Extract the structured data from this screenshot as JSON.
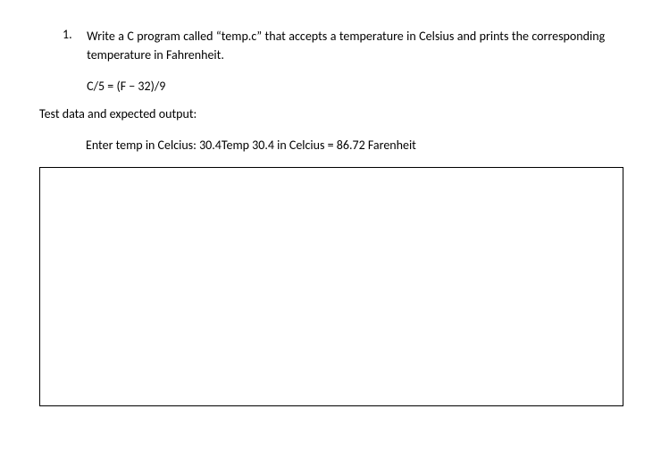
{
  "question": {
    "number": "1.",
    "prompt": "Write a C program called “temp.c” that accepts a temperature in Celsius and prints the corresponding temperature in Fahrenheit.",
    "formula": "C/5 = (F − 32)/9"
  },
  "test": {
    "label": "Test data and expected output:",
    "output": "Enter temp in Celcius: 30.4Temp 30.4 in Celcius = 86.72 Farenheit"
  }
}
